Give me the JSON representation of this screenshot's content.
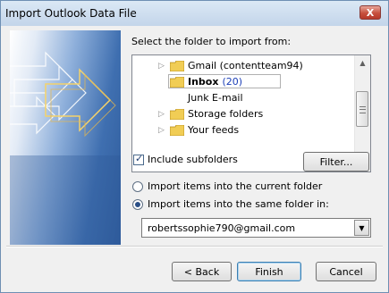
{
  "window": {
    "title": "Import Outlook Data File",
    "close_glyph": "X"
  },
  "prompt": "Select the folder to import from:",
  "tree": {
    "items": [
      {
        "label": "Gmail (contentteam94)",
        "expandable": true
      },
      {
        "label": "Inbox",
        "count": "(20)",
        "selected": true
      },
      {
        "label": "Junk E-mail"
      },
      {
        "label": "Storage folders",
        "expandable": true
      },
      {
        "label": "Your feeds",
        "expandable": true
      }
    ]
  },
  "options": {
    "include_subfolders": {
      "label": "Include subfolders",
      "checked": true
    },
    "filter_button": "Filter...",
    "radio_current": {
      "label": "Import items into the current folder",
      "selected": false
    },
    "radio_same": {
      "label": "Import items into the same folder in:",
      "selected": true
    },
    "folder_select": {
      "value": "robertssophie790@gmail.com"
    }
  },
  "footer": {
    "back": "< Back",
    "finish": "Finish",
    "cancel": "Cancel"
  },
  "colors": {
    "accent": "#2f5c9c",
    "link_count": "#1c3fb7"
  }
}
